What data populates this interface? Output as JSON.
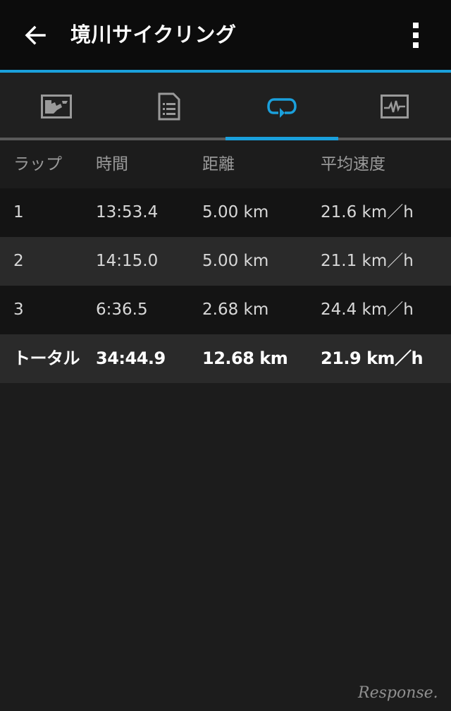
{
  "app_bar": {
    "title": "境川サイクリング",
    "back_icon": "arrow-left-icon",
    "menu_icon": "more-vert-icon"
  },
  "tabs": [
    {
      "icon": "map-icon",
      "selected": false
    },
    {
      "icon": "document-list-icon",
      "selected": false
    },
    {
      "icon": "lap-loop-icon",
      "selected": true
    },
    {
      "icon": "activity-chart-icon",
      "selected": false
    }
  ],
  "colors": {
    "accent": "#1aa0dc",
    "background": "#1c1c1c"
  },
  "table": {
    "headers": [
      "ラップ",
      "時間",
      "距離",
      "平均速度"
    ],
    "rows": [
      [
        "1",
        "13:53.4",
        "5.00 km",
        "21.6 km／h"
      ],
      [
        "2",
        "14:15.0",
        "5.00 km",
        "21.1 km／h"
      ],
      [
        "3",
        "6:36.5",
        "2.68 km",
        "24.4 km／h"
      ]
    ],
    "total": [
      "トータル",
      "34:44.9",
      "12.68 km",
      "21.9 km／h"
    ]
  },
  "watermark": "Response."
}
